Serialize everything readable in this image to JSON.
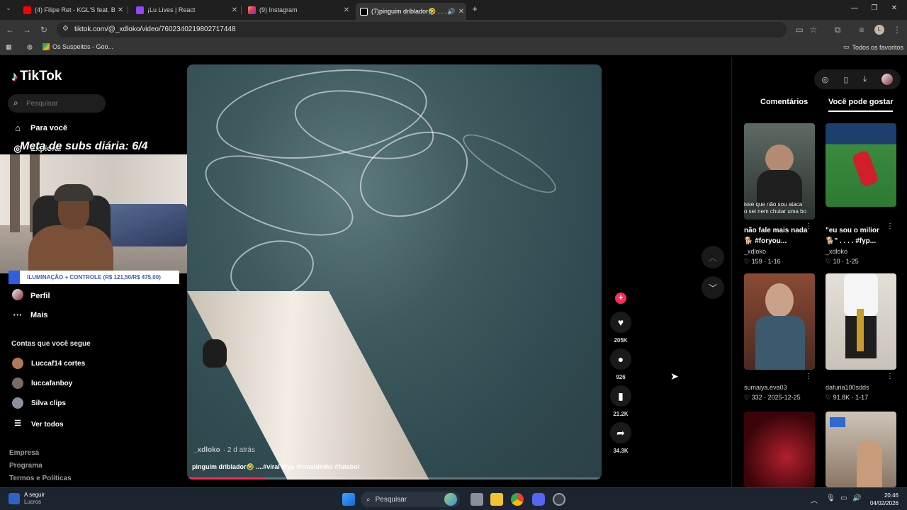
{
  "browser": {
    "tabs": [
      {
        "title": "(4) Filipe Ret - KGL'S feat. BK' &",
        "favicon": "youtube-icon",
        "color": "#ff0000"
      },
      {
        "title": "¡Lu Lives | React",
        "favicon": "twitch-icon",
        "color": "#9146ff"
      },
      {
        "title": "(9) Instagram",
        "favicon": "instagram-icon",
        "color": "#e1306c"
      },
      {
        "title": "(7)pinguim driblador🤣 . . .",
        "favicon": "tiktok-icon",
        "color": "#ffffff"
      }
    ],
    "url": "tiktok.com/@_xdloko/video/7602340219802717448",
    "bookmarks": [
      {
        "label": "Os Suspeitos - Goo..."
      }
    ],
    "bookmarks_right": "Todos os favoritos",
    "profile_initial": "L"
  },
  "tiktok": {
    "brand": "TikTok",
    "search_placeholder": "Pesquisar",
    "nav": {
      "for_you": "Para você",
      "explore": "Explorar",
      "profile": "Perfil",
      "more": "Mais"
    },
    "overlay_title": "Meta de subs diária: 6/4",
    "banner": "ILUMINAÇÃO + CONTROLE (R$ 121,50/R$ 475,00)",
    "following_header": "Contas que você segue",
    "following": [
      {
        "name": "Luccaf14 cortes",
        "color": "#b07a5a"
      },
      {
        "name": "luccafanboy",
        "color": "#7d6a63"
      },
      {
        "name": "Silva clips",
        "color": "#8b8fa0"
      }
    ],
    "see_all": "Ver todos",
    "footer": [
      "Empresa",
      "Programa",
      "Termos e Políticas"
    ],
    "video": {
      "author": "_xdloko",
      "when": "· 2 d atrás",
      "caption": "pinguim driblador🤣 ....#viral #fyp #ronaldinho #futebol",
      "progress": 0.19
    },
    "actions": {
      "likes": "205K",
      "comments": "926",
      "saves": "21.2K",
      "shares": "34.3K"
    },
    "right_tabs": {
      "comments": "Comentários",
      "you_may_like": "Você pode gostar"
    },
    "recommended": [
      {
        "title": "não fale mais nada 🐕 #foryou...",
        "user": "_xdloko",
        "views": "159",
        "date": "1-16",
        "overlay": "isse que não sou ataca\no sei nem chutar uma bo",
        "bg": "#3f4a45"
      },
      {
        "title": "\"eu sou o milior 🐕\" . . . . #fyp...",
        "user": "_xdloko",
        "views": "10",
        "date": "1-25",
        "overlay": "",
        "bg": "#2f7a3a"
      },
      {
        "title": "",
        "user": "sumaiya.eva03",
        "views": "332",
        "date": "2025-12-25",
        "overlay": "",
        "bg": "#6b3a2a"
      },
      {
        "title": "",
        "user": "dafuria100sdds",
        "views": "91.8K",
        "date": "1-17",
        "overlay": "",
        "bg": "#d8d4cc"
      },
      {
        "title": "",
        "user": "",
        "views": "",
        "date": "",
        "overlay": "",
        "bg": "#5a0b14"
      },
      {
        "title": "",
        "user": "",
        "views": "",
        "date": "",
        "overlay": "",
        "bg": "#9a8270"
      }
    ]
  },
  "taskbar": {
    "weather_title": "A seguir",
    "weather_sub": "Lucros",
    "search": "Pesquisar",
    "time": "20:46",
    "date": "04/02/2026"
  }
}
